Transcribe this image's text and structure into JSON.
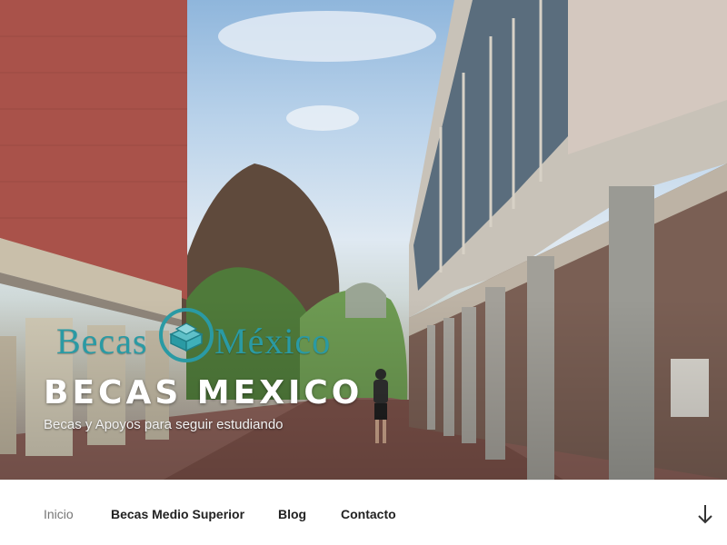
{
  "site": {
    "logo_word_1": "Becas",
    "logo_word_2": "México",
    "title": "BECAS MEXICO",
    "description": "Becas y Apoyos para seguir estudiando"
  },
  "nav": {
    "items": [
      {
        "label": "Inicio",
        "current": true
      },
      {
        "label": "Becas Medio Superior",
        "current": false
      },
      {
        "label": "Blog",
        "current": false
      },
      {
        "label": "Contacto",
        "current": false
      }
    ],
    "scroll_icon": "arrow-down-icon"
  },
  "colors": {
    "logo_teal": "#2a9aa4",
    "nav_text": "#222222",
    "nav_current": "#767676"
  }
}
